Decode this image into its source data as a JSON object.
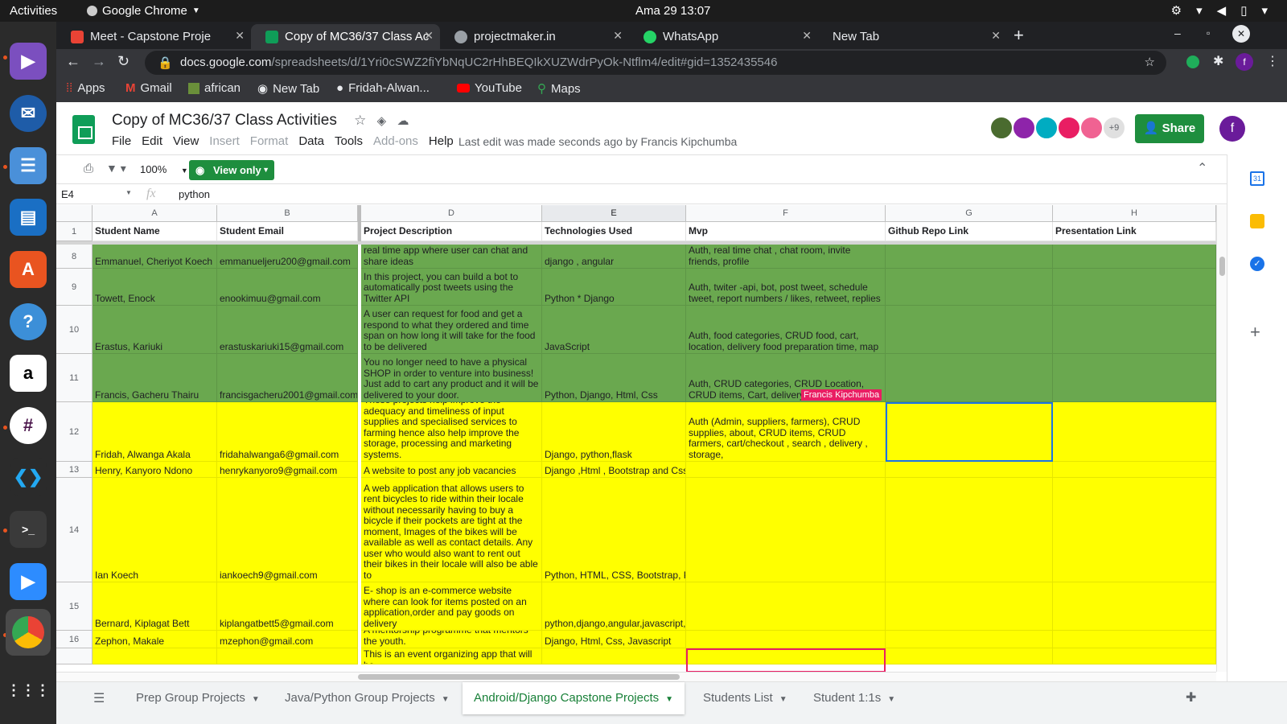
{
  "system": {
    "activities": "Activities",
    "app_name": "Google Chrome",
    "clock": "Ama 29  13:07"
  },
  "browser": {
    "tabs": [
      {
        "label": "Meet - Capstone Proje",
        "color": "#ea4335"
      },
      {
        "label": "Copy of MC36/37 Class Ac",
        "color": "#0f9d58"
      },
      {
        "label": "projectmaker.in",
        "color": "#9aa0a6"
      },
      {
        "label": "WhatsApp",
        "color": "#25d366"
      },
      {
        "label": "New Tab",
        "color": ""
      }
    ],
    "url_domain": "docs.google.com",
    "url_path": "/spreadsheets/d/1Yri0cSWZ2fiYbNqUC2rHhBEQIkXUZWdrPyOk-Ntflm4/edit#gid=1352435546",
    "bookmarks": [
      "Apps",
      "Gmail",
      "african",
      "New Tab",
      "Fridah-Alwan...",
      "YouTube",
      "Maps"
    ]
  },
  "sheets": {
    "title": "Copy of MC36/37 Class Activities",
    "menu": [
      "File",
      "Edit",
      "View",
      "Insert",
      "Format",
      "Data",
      "Tools",
      "Add-ons",
      "Help"
    ],
    "last_edit": "Last edit was made seconds ago by Francis Kipchumba",
    "collaborators_more": "+9",
    "share_label": "Share",
    "profile_initial": "f",
    "zoom": "100%",
    "view_only": "View only",
    "name_box": "E4",
    "formula_value": "python",
    "columns": [
      "A",
      "B",
      "D",
      "E",
      "F",
      "G",
      "H"
    ],
    "headers": [
      "Student Name",
      "Student Email",
      "Project Description",
      "Technologies Used",
      "Mvp",
      "Github Repo Link",
      "Presentation Link"
    ],
    "rows": [
      {
        "num": "8",
        "color": "green",
        "cells": [
          "Emmanuel,   Cheriyot Koech",
          "emmanueljeru200@gmail.com",
          "real time app where user  can chat and share ideas",
          "django , angular",
          "Auth, real time chat ,  chat room, invite friends, profile",
          "",
          ""
        ]
      },
      {
        "num": "9",
        "color": "green",
        "cells": [
          "Towett,  Enock",
          "enookimuu@gmail.com",
          "In this project, you can build a bot to automatically post tweets using the Twitter API",
          "Python * Django",
          "Auth,  twiter -api,  bot,  post tweet, schedule tweet, report numbers / likes, retweet, replies",
          "",
          ""
        ]
      },
      {
        "num": "10",
        "color": "green",
        "cells": [
          "Erastus, Kariuki",
          "erastuskariuki15@gmail.com",
          "A user can request for food and get a respond to what they ordered and time span on how long it will take for the food to be delivered",
          "JavaScript",
          "Auth, food categories, CRUD food, cart, location, delivery  food preparation time, map",
          "",
          ""
        ]
      },
      {
        "num": "11",
        "color": "green",
        "cells": [
          "Francis,  Gacheru Thairu",
          "francisgacheru2001@gmail.com",
          "You no longer need to have a physical SHOP in order to venture into business! Just add to cart any product and it will be delivered to your door.",
          "Python, Django, Html, Css",
          "Auth, CRUD categories, CRUD Location, CRUD items, Cart, delivery,",
          "",
          ""
        ]
      },
      {
        "num": "12",
        "color": "yellow",
        "cells": [
          "Fridah,  Alwanga Akala",
          "fridahalwanga6@gmail.com",
          "These projects help improve the adequacy and timeliness of input supplies and specialised services to farming hence also help improve the storage, processing and marketing systems.",
          "Django, python,flask",
          "Auth (Admin, suppliers, farmers), CRUD supplies, about, CRUD items, CRUD farmers, cart/checkout , search , delivery , storage,",
          "",
          ""
        ]
      },
      {
        "num": "13",
        "color": "yellow",
        "cells": [
          "Henry,  Kanyoro Ndono",
          "henrykanyoro9@gmail.com",
          "A website to post any job vacancies",
          "Django ,Html , Bootstrap and Css",
          "",
          "",
          ""
        ]
      },
      {
        "num": "14",
        "color": "yellow",
        "cells": [
          "Ian Koech",
          "iankoech9@gmail.com",
          "A web application that allows users to rent bicycles to ride within their locale without necessarily having to buy a bicycle if their pockets are tight at the moment, Images of the bikes will be available as well as contact details. Any user who would also want to rent out their bikes in their locale will also be able to",
          "Python, HTML, CSS, Bootstrap, Po",
          "",
          "",
          ""
        ]
      },
      {
        "num": "15",
        "color": "yellow",
        "cells": [
          "Bernard,  Kiplagat Bett",
          "kiplangatbett5@gmail.com",
          "E- shop is an e-commerce website where can look for items  posted on an application,order and pay goods on delivery",
          "python,django,angular,javascript,b",
          "",
          "",
          ""
        ]
      },
      {
        "num": "16",
        "color": "yellow",
        "cells": [
          "Zephon,  Makale",
          "mzephon@gmail.com",
          "A mentorship programme that mentors the youth.",
          "Django, Html, Css, Javascript",
          "",
          "",
          ""
        ]
      },
      {
        "num": "",
        "color": "yellow",
        "cells": [
          "",
          "",
          "This is an event organizing app that will be",
          "",
          "",
          "",
          ""
        ]
      }
    ],
    "cursor_label": "Francis Kipchumba",
    "sheet_tabs": [
      "Prep Group Projects",
      "Java/Python Group Projects",
      "Android/Django Capstone Projects",
      "Students List",
      "Student 1:1s"
    ],
    "active_tab_index": 2
  }
}
